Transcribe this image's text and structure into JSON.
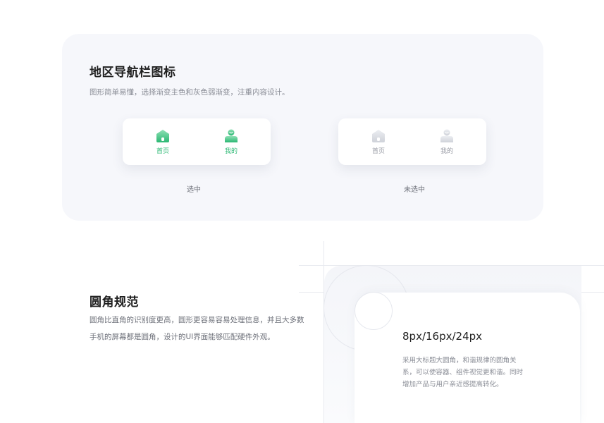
{
  "nav_section": {
    "title": "地区导航栏图标",
    "subtitle": "图形简单易懂，选择渐变主色和灰色弱渐变，注重内容设计。",
    "selected": {
      "caption": "选中",
      "items": [
        {
          "label": "首页",
          "icon": "home-icon"
        },
        {
          "label": "我的",
          "icon": "user-icon"
        }
      ]
    },
    "unselected": {
      "caption": "未选中",
      "items": [
        {
          "label": "首页",
          "icon": "home-icon"
        },
        {
          "label": "我的",
          "icon": "user-icon"
        }
      ]
    },
    "colors": {
      "accent": "#2bb873",
      "accent_light": "#8fe0b5",
      "inactive": "#d6d8de",
      "panel": "#f6f7fb"
    }
  },
  "radius_section": {
    "title": "圆角规范",
    "body_line1": "圆角比直角的识别度更高，圆形更容易容易处理信息，并且大多数",
    "body_line2": "手机的屏幕都是圆角，设计的UI界面能够匹配硬件外观。",
    "spec_title": "8px/16px/24px",
    "spec_desc": "采用大标题大圆角，和谐规律的圆角关系，可以使容器、组件视觉更和谐。同时增加产品与用户亲近感提高转化。"
  }
}
